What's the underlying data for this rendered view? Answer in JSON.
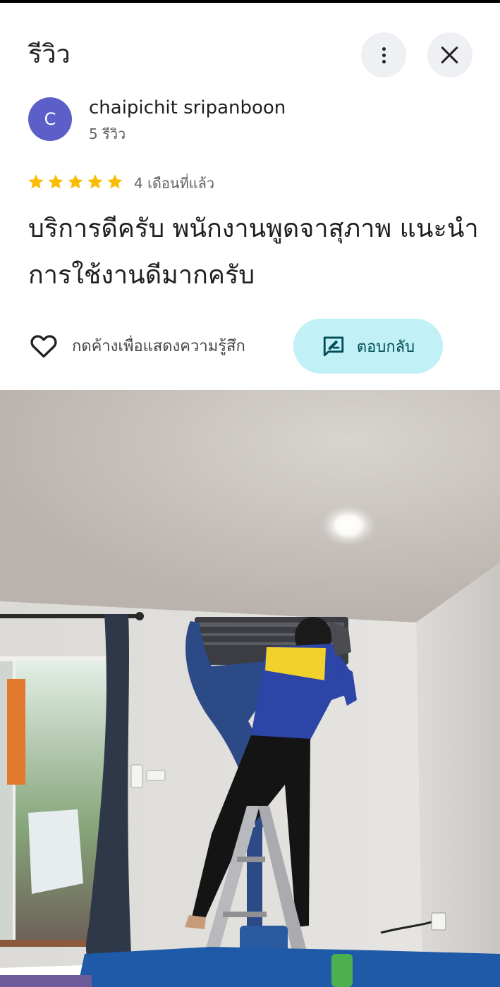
{
  "header": {
    "title": "รีวิว",
    "more_icon": "more-vert-icon",
    "close_icon": "close-icon"
  },
  "review": {
    "avatar_letter": "C",
    "avatar_color": "#5b5fc7",
    "author": "chaipichit sripanboon",
    "review_count": "5 รีวิว",
    "rating": 5,
    "rating_max": 5,
    "star_color": "#fbbc04",
    "time": "4 เดือนที่แล้ว",
    "text": "บริการดีครับ พนักงานพูดจาสุภาพ แนะนำการใช้งานดีมากครับ"
  },
  "actions": {
    "like_label": "กดค้างเพื่อแสดงความรู้สึก",
    "like_icon": "heart-outline-icon",
    "reply_label": "ตอบกลับ",
    "reply_icon": "reply-edit-icon",
    "reply_bg": "#c2f0f7"
  },
  "photo": {
    "subject": "technician on ladder cleaning wall air conditioner"
  }
}
